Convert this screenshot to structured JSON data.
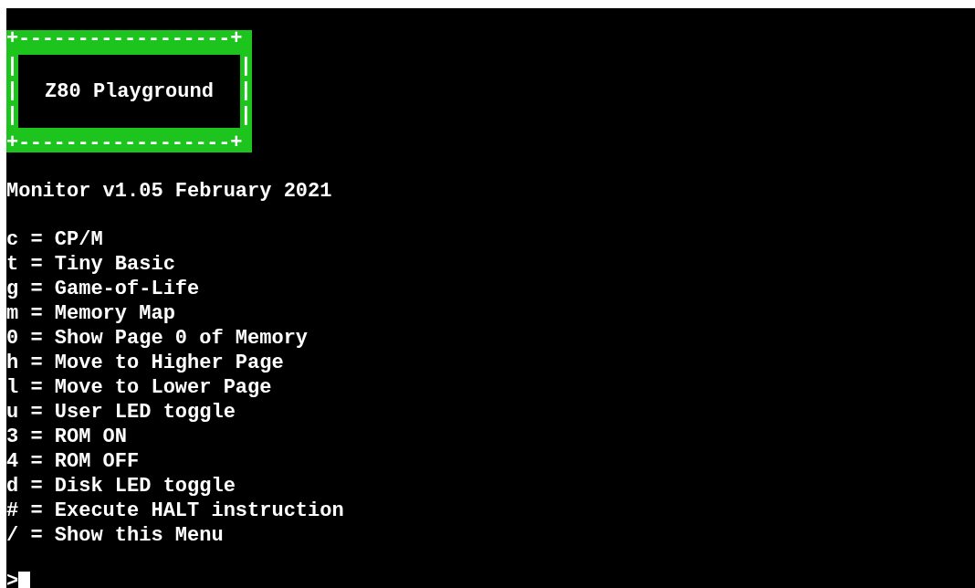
{
  "banner": {
    "border_top": "+------------------+",
    "left_side": [
      "|",
      "|",
      "|"
    ],
    "title": "Z80 Playground",
    "right_side": [
      "|",
      "|",
      "|"
    ],
    "border_bottom": "+------------------+"
  },
  "version": "Monitor v1.05 February 2021",
  "menu": [
    "c = CP/M",
    "t = Tiny Basic",
    "g = Game-of-Life",
    "m = Memory Map",
    "0 = Show Page 0 of Memory",
    "h = Move to Higher Page",
    "l = Move to Lower Page",
    "u = User LED toggle",
    "3 = ROM ON",
    "4 = ROM OFF",
    "d = Disk LED toggle",
    "# = Execute HALT instruction",
    "/ = Show this Menu"
  ],
  "prompt": ">"
}
